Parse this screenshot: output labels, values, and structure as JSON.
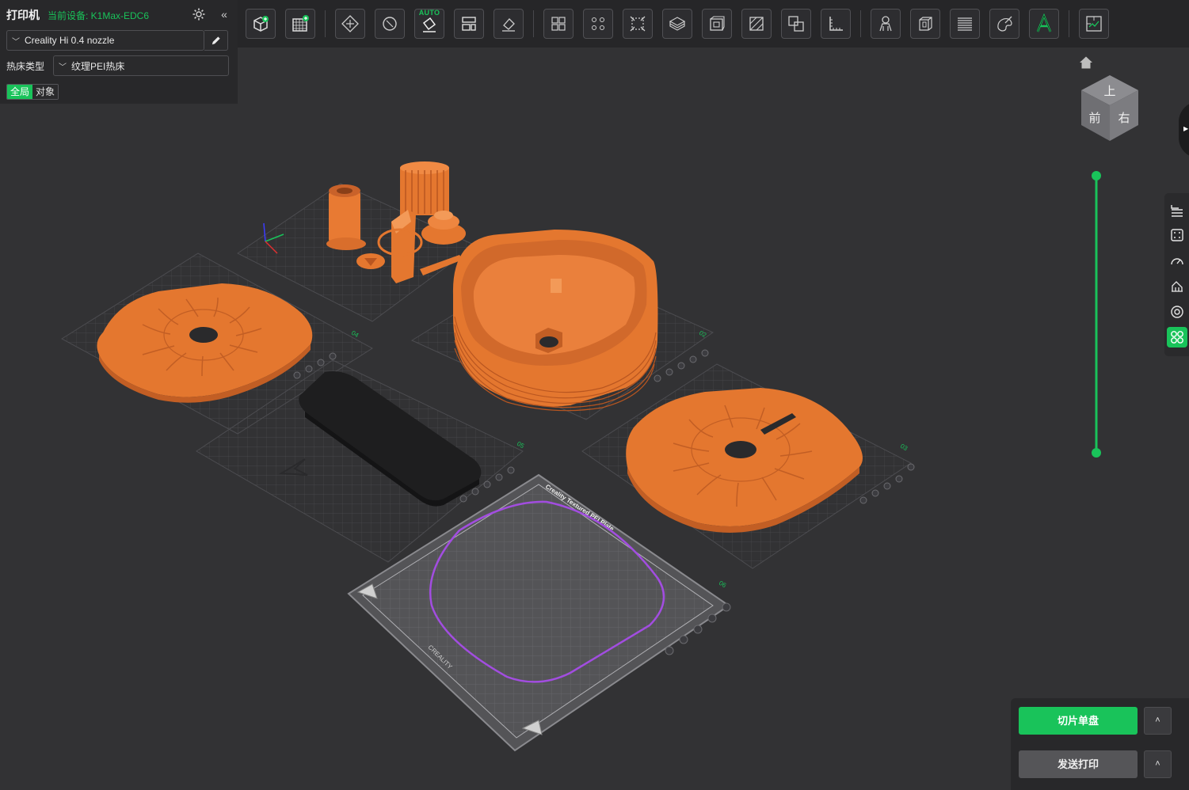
{
  "printer": {
    "title": "打印机",
    "current_device": "当前设备: K1Max-EDC6",
    "collapse": "«",
    "nozzle": "Creality Hi 0.4 nozzle",
    "bed_type_label": "热床类型",
    "bed_type_value": "纹理PEI热床",
    "scope_tabs": [
      "全局",
      "对象"
    ],
    "active_scope": "全局"
  },
  "toolbar": {
    "items": [
      "add-object-icon",
      "add-plate-icon",
      "auto-orient-icon",
      "rotate-icon",
      "auto-arrange-icon",
      "layout-icon",
      "lay-on-face-icon",
      "split-objects-icon",
      "split-parts-icon",
      "scale-icon",
      "cut-icon",
      "hollow-icon",
      "support-paint-icon",
      "boolean-icon",
      "measure-icon",
      "support-icon",
      "seam-icon",
      "layer-icon",
      "color-paint-icon",
      "text-icon",
      "assembly-icon"
    ],
    "auto_label": "AUTO"
  },
  "viewport": {
    "plates": [
      {
        "label": "04"
      },
      {
        "label": "02"
      },
      {
        "label": "05"
      },
      {
        "label": "03"
      },
      {
        "label": "06"
      }
    ],
    "plate_text": "Creality Textured PEI Plate",
    "brand_text": "CREALITY",
    "navcube": {
      "top": "上",
      "front": "前",
      "right": "右"
    }
  },
  "side_tools": [
    "object-list-icon",
    "plate-settings-icon",
    "speed-icon",
    "support-settings-icon",
    "filament-icon",
    "layout-grid-icon"
  ],
  "actions": {
    "slice": "切片单盘",
    "send": "发送打印",
    "more": "˄"
  },
  "colors": {
    "accent": "#19c35a",
    "model_orange": "#ee7b32",
    "toolpath_purple": "#a24de0",
    "background": "#323234"
  }
}
